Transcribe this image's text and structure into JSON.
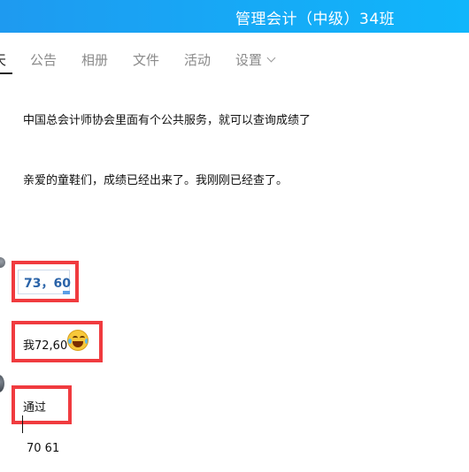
{
  "header": {
    "title": "管理会计（中级）34班"
  },
  "tabs": [
    {
      "label": "天",
      "active": true
    },
    {
      "label": "公告"
    },
    {
      "label": "相册"
    },
    {
      "label": "文件"
    },
    {
      "label": "活动"
    },
    {
      "label": "设置"
    }
  ],
  "messages": [
    {
      "text": "中国总会计师协会里面有个公共服务，就可以查询成绩了"
    },
    {
      "text": "亲爱的童鞋们，成绩已经出来了。我刚刚已经查了。"
    },
    {
      "text": "73，60"
    },
    {
      "text": "我72,60"
    },
    {
      "text": "通过"
    }
  ],
  "input": {
    "value": "70 61"
  },
  "colors": {
    "title_bar": "#1e9af0",
    "highlight_box": "#f03b3f",
    "bubble_text": "#2a63a8"
  },
  "icons": {
    "emoji": "laughing-tears-emoji",
    "dropdown": "chevron-down-icon"
  }
}
